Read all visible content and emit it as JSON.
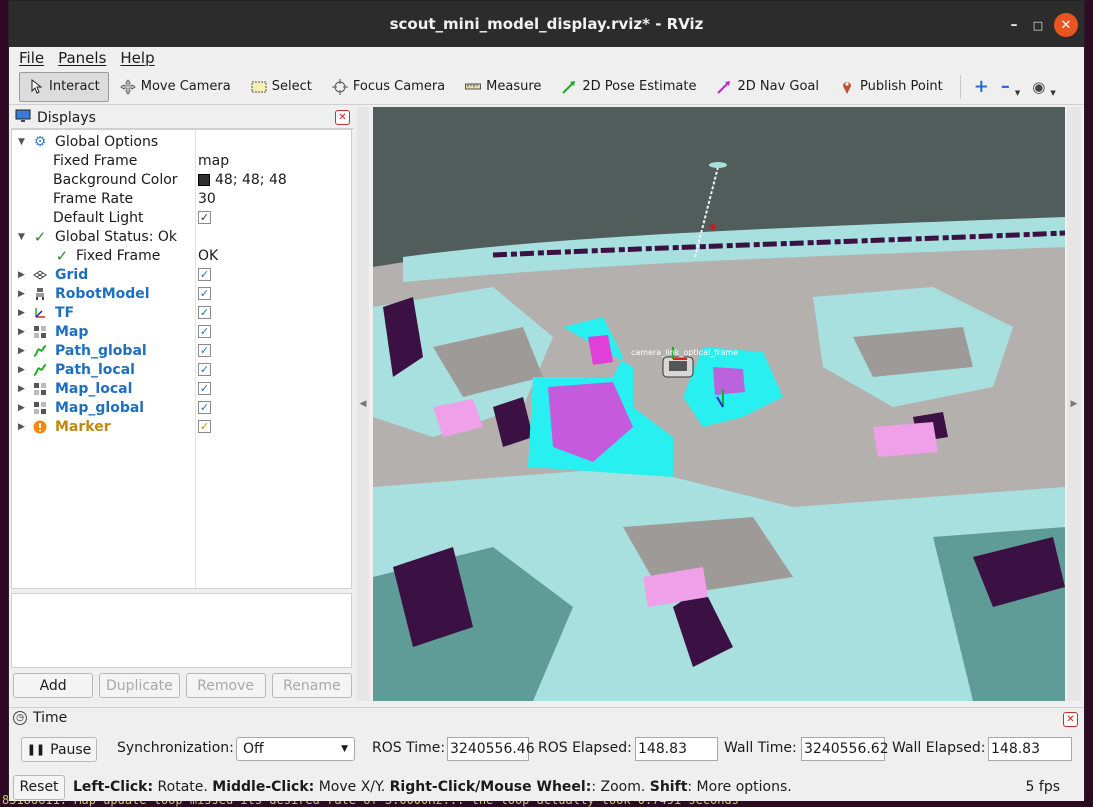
{
  "window": {
    "title": "scout_mini_model_display.rviz* - RViz"
  },
  "menu": [
    "File",
    "Panels",
    "Help"
  ],
  "toolbar": [
    {
      "label": "Interact",
      "icon": "interact-cursor-icon",
      "active": true
    },
    {
      "label": "Move Camera",
      "icon": "move-camera-icon"
    },
    {
      "label": "Select",
      "icon": "select-icon"
    },
    {
      "label": "Focus Camera",
      "icon": "focus-camera-icon"
    },
    {
      "label": "Measure",
      "icon": "measure-icon"
    },
    {
      "label": "2D Pose Estimate",
      "icon": "pose-estimate-arrow-icon"
    },
    {
      "label": "2D Nav Goal",
      "icon": "nav-goal-arrow-icon"
    },
    {
      "label": "Publish Point",
      "icon": "publish-point-pin-icon"
    }
  ],
  "displays": {
    "title": "Displays",
    "global_options": {
      "label": "Global Options",
      "rows": [
        {
          "name": "Fixed Frame",
          "value": "map"
        },
        {
          "name": "Background Color",
          "value": "48; 48; 48",
          "swatch": "#303030"
        },
        {
          "name": "Frame Rate",
          "value": "30"
        },
        {
          "name": "Default Light",
          "checked": true
        }
      ]
    },
    "global_status": {
      "label": "Global Status: Ok",
      "child_label": "Fixed Frame",
      "child_value": "OK"
    },
    "items": [
      {
        "label": "Grid",
        "icon": "grid-icon",
        "checked": true
      },
      {
        "label": "RobotModel",
        "icon": "robot-model-icon",
        "checked": true
      },
      {
        "label": "TF",
        "icon": "tf-axes-icon",
        "checked": true
      },
      {
        "label": "Map",
        "icon": "map-icon",
        "checked": true
      },
      {
        "label": "Path_global",
        "icon": "path-icon",
        "checked": true
      },
      {
        "label": "Path_local",
        "icon": "path-icon",
        "checked": true
      },
      {
        "label": "Map_local",
        "icon": "map-icon",
        "checked": true
      },
      {
        "label": "Map_global",
        "icon": "map-icon",
        "checked": true
      },
      {
        "label": "Marker",
        "icon": "warning-icon",
        "checked": true,
        "warning": true
      }
    ],
    "buttons": {
      "add": "Add",
      "duplicate": "Duplicate",
      "remove": "Remove",
      "rename": "Rename"
    }
  },
  "time": {
    "title": "Time",
    "pause": "Pause",
    "sync_label": "Synchronization:",
    "sync_value": "Off",
    "ros_time_label": "ROS Time:",
    "ros_time": "3240556.46",
    "ros_elapsed_label": "ROS Elapsed:",
    "ros_elapsed": "148.83",
    "wall_time_label": "Wall Time:",
    "wall_time": "3240556.62",
    "wall_elapsed_label": "Wall Elapsed:",
    "wall_elapsed": "148.83"
  },
  "status": {
    "reset": "Reset",
    "left_click": "Left-Click:",
    "left_click_desc": " Rotate. ",
    "middle_click": "Middle-Click:",
    "middle_click_desc": " Move X/Y. ",
    "right_click": "Right-Click/Mouse Wheel:",
    "right_click_desc": ": Zoom. ",
    "shift": "Shift",
    "shift_desc": ": More options.",
    "fps": "5 fps"
  },
  "terminal_line": "85186611: Map update loop missed its desired rate of 3.0000Hz... the loop actually took 0.7491 seconds",
  "viewport": {
    "robot_frame_label": "camera_link_optical_frame",
    "colors": {
      "sky": "#505d5b",
      "floor": "#b4b0ae",
      "light_cyan": "#a8e0df",
      "teal": "#5f9b97",
      "dark_purple": "#3a1142",
      "magenta": "#e040d8",
      "cyan": "#28f0f0",
      "pink": "#f0a0e8"
    }
  }
}
